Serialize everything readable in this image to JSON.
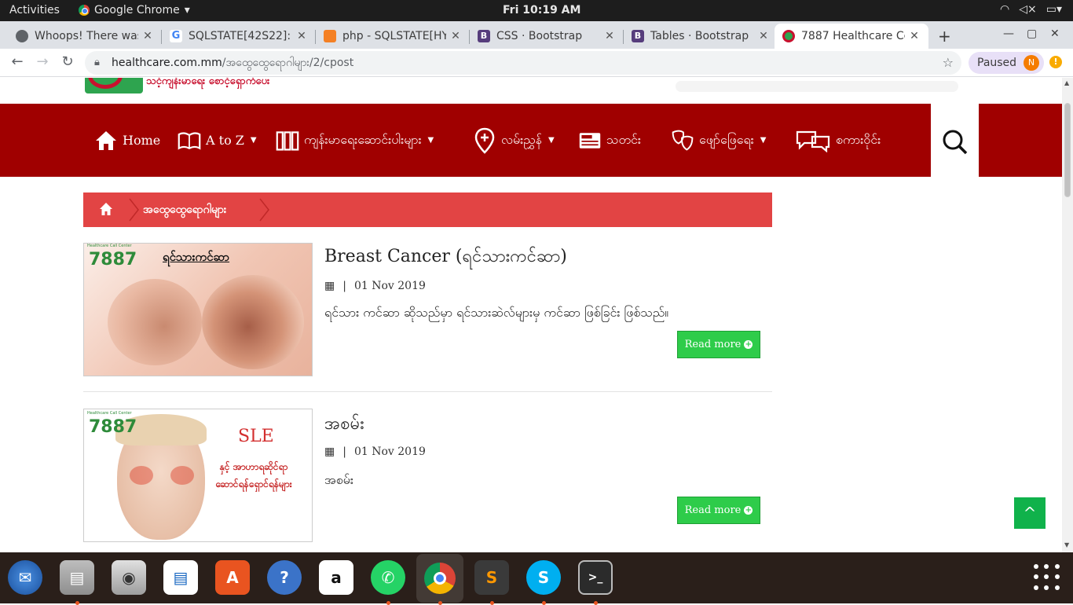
{
  "system": {
    "activities": "Activities",
    "app_name": "Google Chrome",
    "clock": "Fri 10:19 AM"
  },
  "tabs": [
    {
      "title": "Whoops! There was",
      "icon": "warning-icon"
    },
    {
      "title": "SQLSTATE[42S22]: C",
      "icon": "google-icon"
    },
    {
      "title": "php - SQLSTATE[HY",
      "icon": "stackoverflow-icon"
    },
    {
      "title": "CSS · Bootstrap",
      "icon": "bootstrap-icon"
    },
    {
      "title": "Tables · Bootstrap",
      "icon": "bootstrap-icon"
    },
    {
      "title": "7887 Healthcare Ce",
      "icon": "healthcare-icon"
    }
  ],
  "address": {
    "domain": "healthcare.com.mm",
    "path": "/အထွေထွေရောဂါများ/2/cpost"
  },
  "profile": {
    "label": "Paused",
    "initial": "N"
  },
  "site": {
    "tagline": "သင့်ကျန်းမာရေး စောင့်ရှောက်ပေး"
  },
  "nav": [
    {
      "label": "Home",
      "icon": "home-icon",
      "dropdown": false
    },
    {
      "label": "A to Z",
      "icon": "book-icon",
      "dropdown": true
    },
    {
      "label": "ကျန်းမာရေးဆောင်းပါးများ",
      "icon": "books-icon",
      "dropdown": true
    },
    {
      "label": "လမ်းညွှန်",
      "icon": "location-pin-icon",
      "dropdown": true
    },
    {
      "label": "သတင်း",
      "icon": "newspaper-icon",
      "dropdown": false
    },
    {
      "label": "ဖျော်ဖြေရေး",
      "icon": "theater-masks-icon",
      "dropdown": true
    },
    {
      "label": "စကားဝိုင်း",
      "icon": "chat-bubbles-icon",
      "dropdown": false
    }
  ],
  "breadcrumb": {
    "current": "အထွေထွေရောဂါများ"
  },
  "posts": [
    {
      "title": "Breast Cancer (ရင်သားကင်ဆာ)",
      "date": "01 Nov 2019",
      "excerpt": "ရင်သား ကင်ဆာ ဆိုသည်မှာ ရင်သားဆဲလ်များမှ ကင်ဆာ ဖြစ်ခြင်း ဖြစ်သည်။",
      "thumb_badge": "7887",
      "thumb_label": "ရင်သားကင်ဆာ",
      "read_more": "Read more"
    },
    {
      "title": "အစမ်း",
      "date": "01 Nov 2019",
      "excerpt": "အစမ်း",
      "thumb_badge": "7887",
      "thumb_label": "SLE",
      "thumb_sub": "နှင့် အာဟာရဆိုင်ရာ ဆောင်ရန်ရှောင်ရန်များ",
      "read_more": "Read more"
    }
  ],
  "back_to_top": "^",
  "colors": {
    "nav_red": "#a00000",
    "breadcrumb_red": "#e24444",
    "button_green": "#2ecc4a"
  }
}
